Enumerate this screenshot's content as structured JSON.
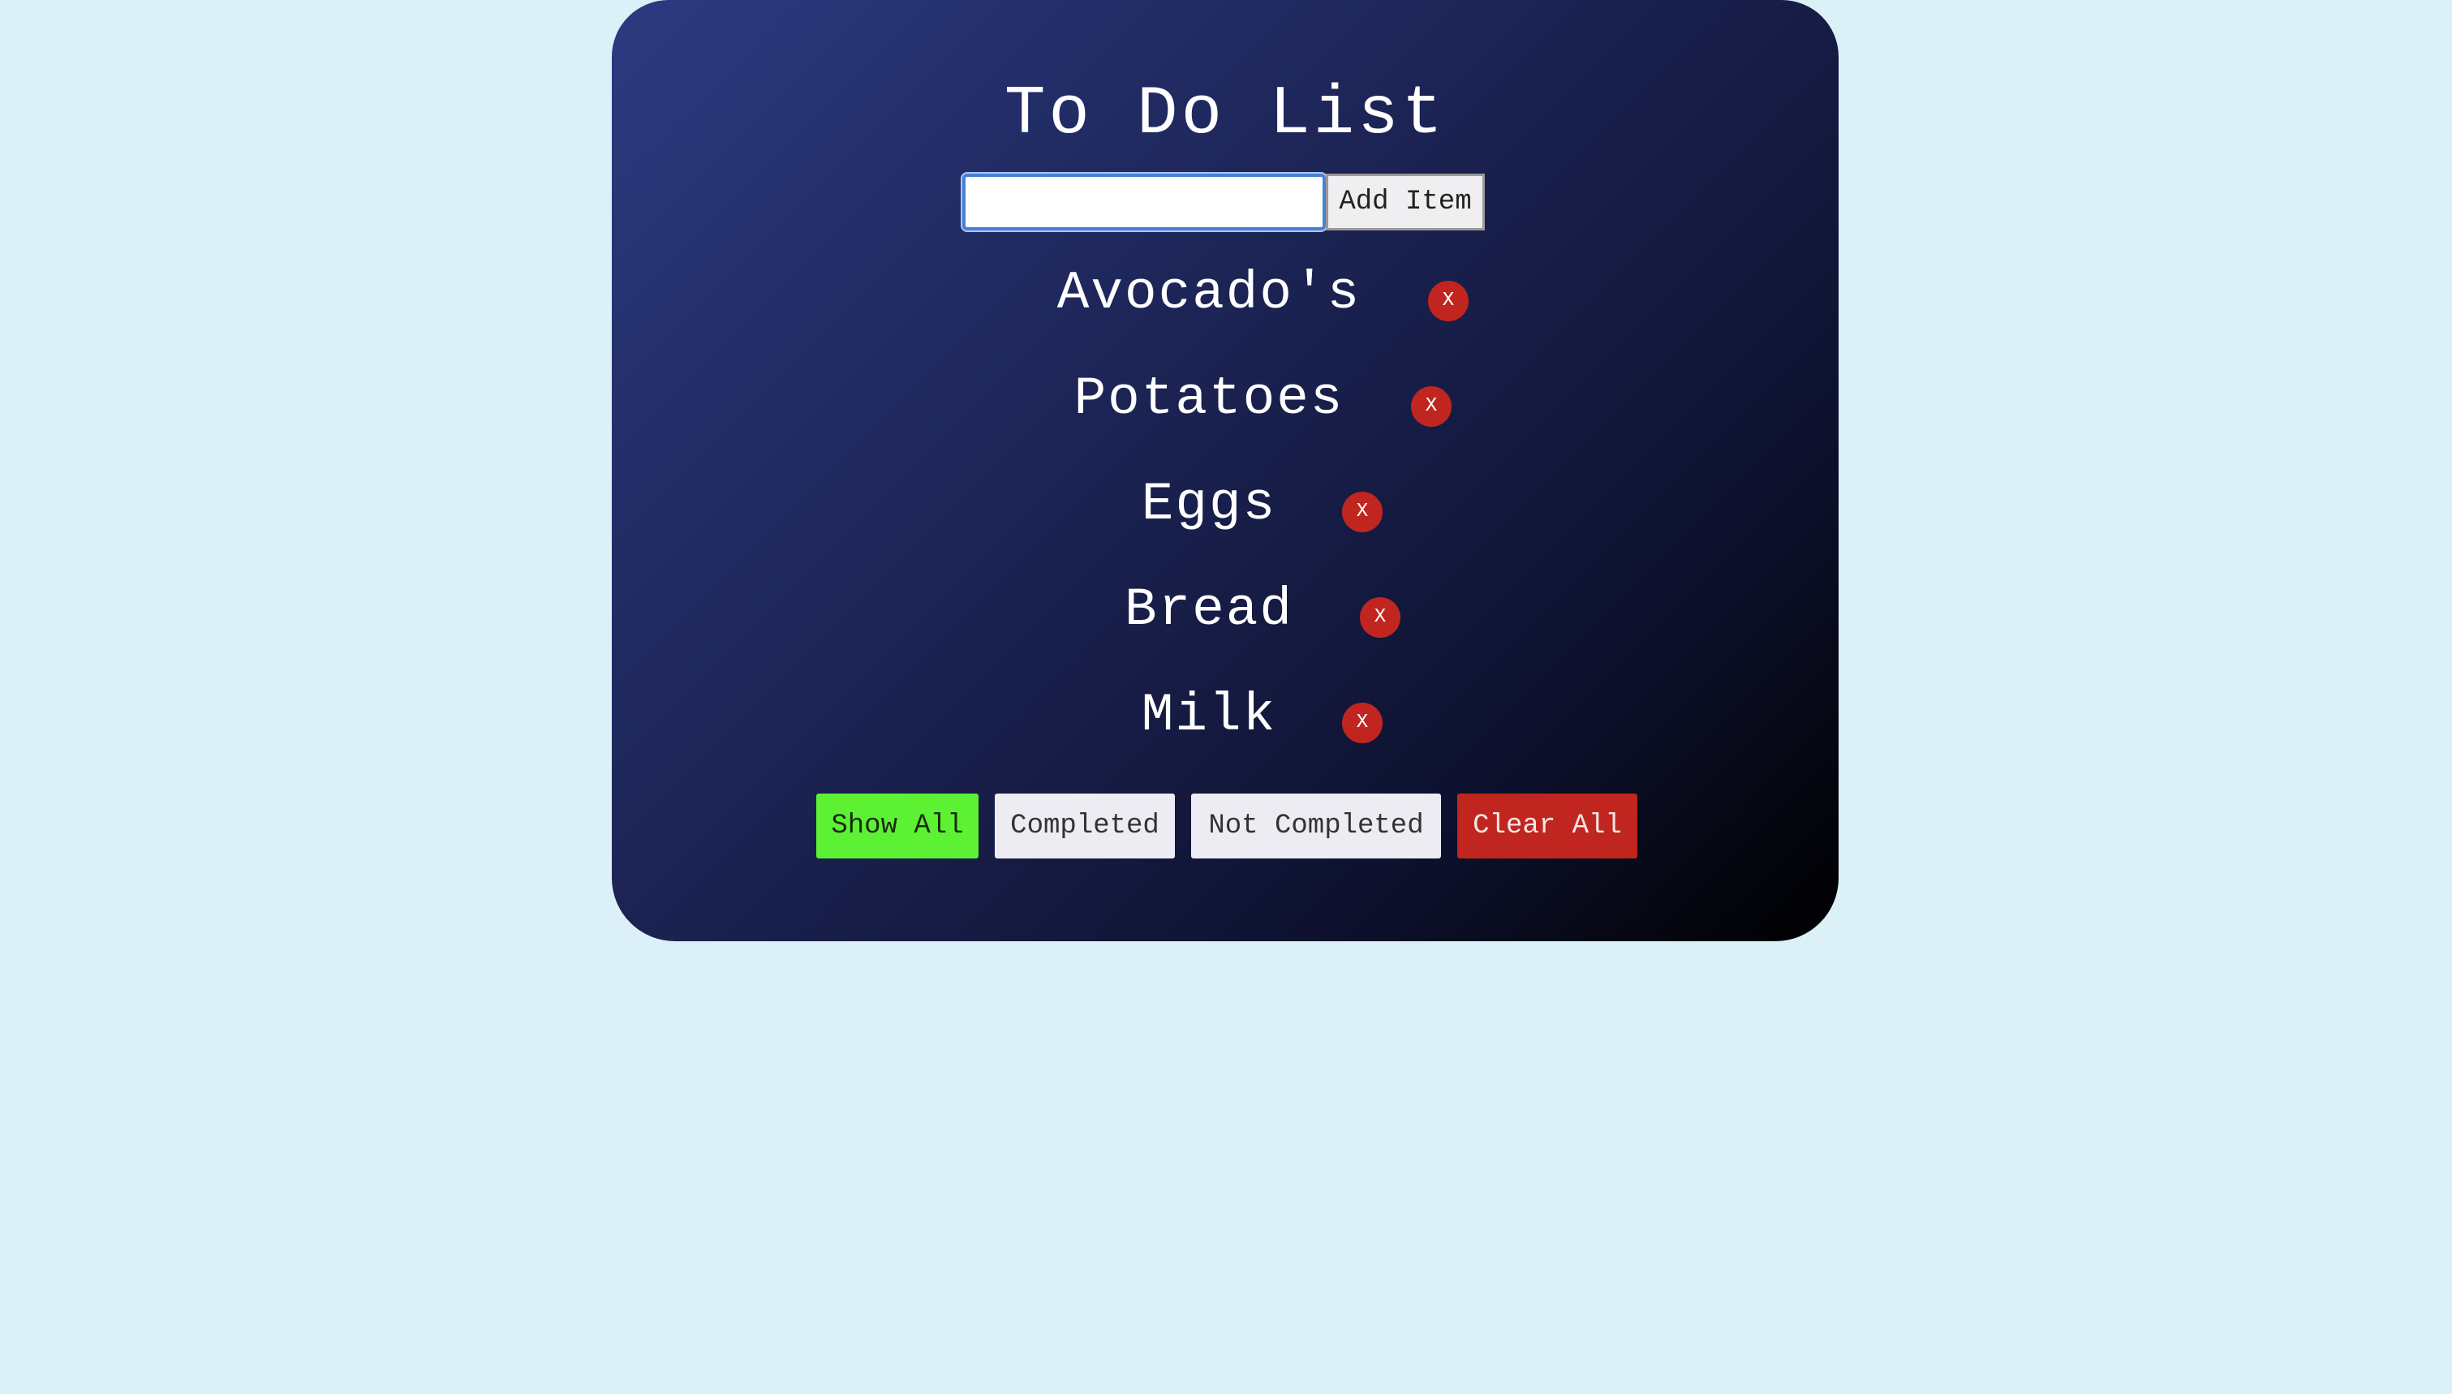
{
  "app": {
    "title": "To Do List"
  },
  "add_form": {
    "input_value": "",
    "input_placeholder": "",
    "add_button_label": "Add Item"
  },
  "items": [
    {
      "text": "Avocado's",
      "delete_label": "X"
    },
    {
      "text": "Potatoes",
      "delete_label": "X"
    },
    {
      "text": "Eggs",
      "delete_label": "X"
    },
    {
      "text": "Bread",
      "delete_label": "X"
    },
    {
      "text": "Milk",
      "delete_label": "X"
    }
  ],
  "filters": {
    "show_all": "Show All",
    "completed": "Completed",
    "not_completed": "Not Completed",
    "clear_all": "Clear All",
    "active_filter": "Show All"
  },
  "colors": {
    "page_background": "#dcf0f7",
    "card_gradient_start": "#2c3a80",
    "card_gradient_end": "#000000",
    "active_filter": "#5cf233",
    "danger": "#c0261f"
  }
}
